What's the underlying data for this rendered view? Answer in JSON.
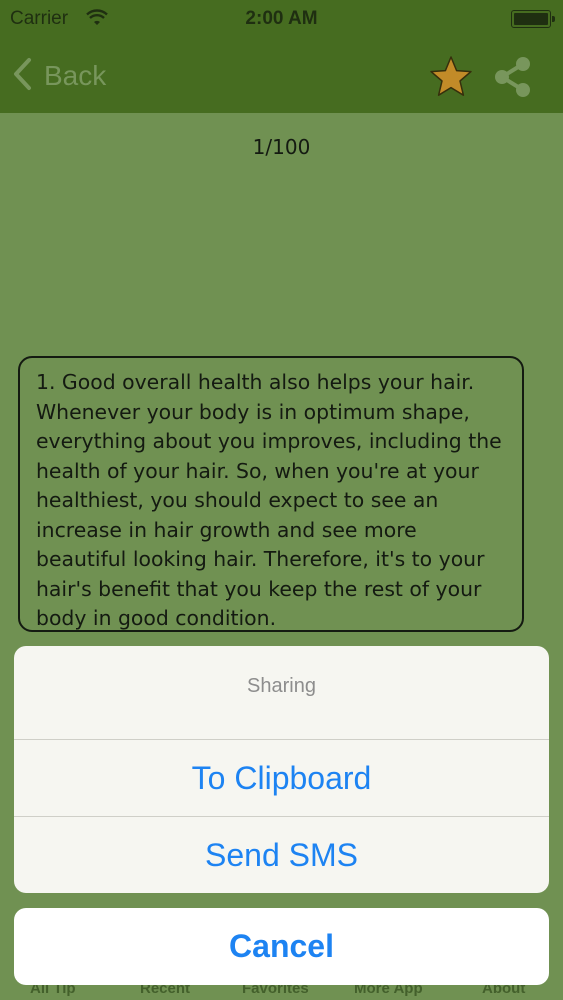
{
  "status_bar": {
    "carrier": "Carrier",
    "time": "2:00 AM"
  },
  "nav": {
    "back_label": "Back",
    "favorite_icon": "star-icon",
    "share_icon": "share-icon",
    "accent": "#e59a2c"
  },
  "tip": {
    "counter": "1/100",
    "text": "1. Good overall health also helps your hair. Whenever your body is in optimum shape, everything about you improves, including the health of your hair. So, when you're at your healthiest, you should expect to see an increase in hair growth and see more beautiful looking hair. Therefore, it's to your hair's benefit that you keep the rest of your body in good condition."
  },
  "tabs": [
    "All Tip",
    "Recent",
    "Favorites",
    "More App",
    "About"
  ],
  "action_sheet": {
    "title": "Sharing",
    "buttons": [
      "To Clipboard",
      "Send SMS"
    ],
    "cancel": "Cancel"
  },
  "colors": {
    "nav_bg": "#4d7423",
    "content_bg": "#80a160",
    "ios_blue": "#1d83f2"
  }
}
